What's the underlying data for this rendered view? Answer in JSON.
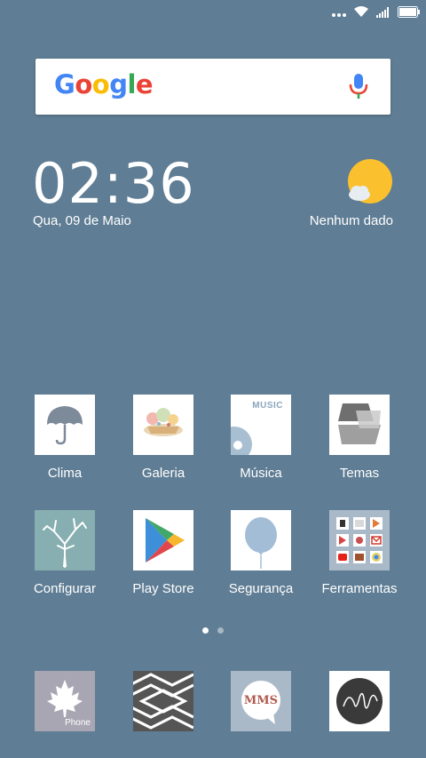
{
  "status_bar": {
    "icons": [
      "more-icon",
      "wifi-icon",
      "signal-icon",
      "battery-icon"
    ]
  },
  "search": {
    "logo": "Google",
    "icons": [
      "mic-icon"
    ]
  },
  "clock": {
    "time": "02:36",
    "date": "Qua, 09 de Maio"
  },
  "weather": {
    "status": "Nenhum dado",
    "icon": "weather-sun-cloud-icon"
  },
  "apps": [
    {
      "label": "Clima",
      "icon": "umbrella-icon"
    },
    {
      "label": "Galeria",
      "icon": "gallery-icon"
    },
    {
      "label": "Música",
      "icon": "music-icon",
      "badge": "MUSIC"
    },
    {
      "label": "Temas",
      "icon": "themes-icon"
    },
    {
      "label": "Configurar",
      "icon": "tree-icon"
    },
    {
      "label": "Play Store",
      "icon": "play-store-icon"
    },
    {
      "label": "Segurança",
      "icon": "balloon-icon"
    },
    {
      "label": "Ferramentas",
      "icon": "tools-folder-icon"
    }
  ],
  "dock": [
    {
      "icon": "phone-icon",
      "text": "Phone"
    },
    {
      "icon": "browser-pattern-icon"
    },
    {
      "icon": "messaging-icon",
      "text": "MMS"
    },
    {
      "icon": "circle-signature-icon"
    }
  ],
  "page_indicator": {
    "pages": 2,
    "current": 1
  },
  "colors": {
    "wallpaper": "#5f7d94",
    "accent_blue": "#4285f4",
    "accent_red": "#ea4335",
    "accent_yellow": "#fbbc05",
    "accent_green": "#34a853",
    "sun_yellow": "#fbc02d"
  }
}
